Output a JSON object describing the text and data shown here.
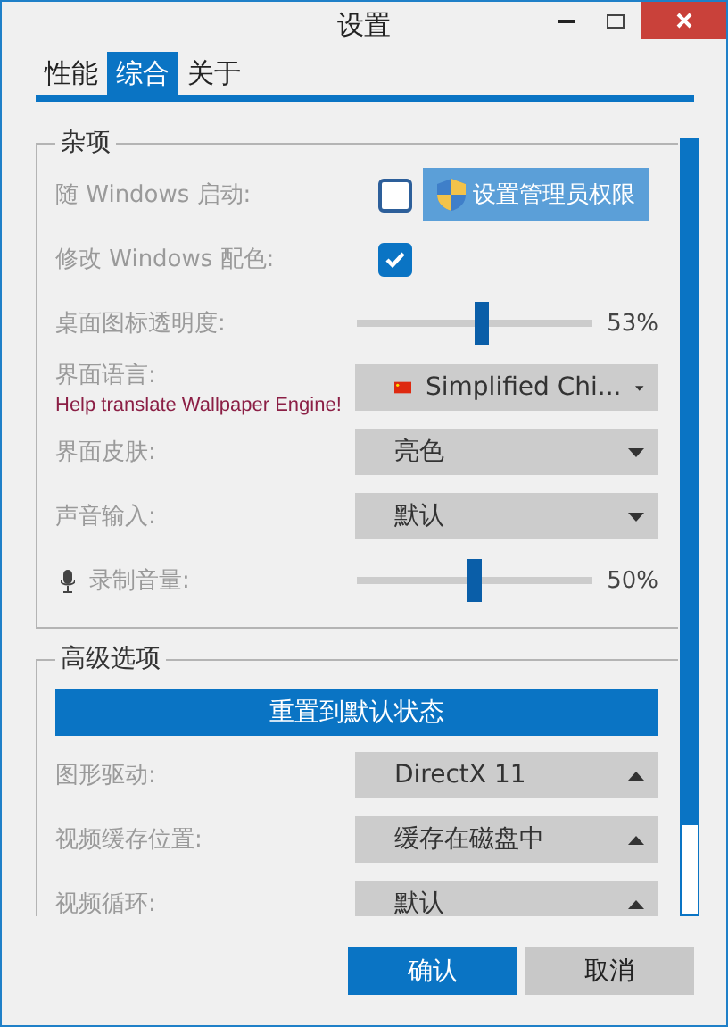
{
  "window": {
    "title": "设置"
  },
  "tabs": [
    {
      "label": "性能",
      "selected": false
    },
    {
      "label": "综合",
      "selected": true
    },
    {
      "label": "关于",
      "selected": false
    }
  ],
  "groups": [
    {
      "title": "杂项",
      "rows": [
        {
          "kind": "checkbox",
          "label": "随 Windows 启动:",
          "checked": false,
          "button": "设置管理员权限"
        },
        {
          "kind": "checkbox",
          "label": "修改 Windows 配色:",
          "checked": true
        },
        {
          "kind": "slider",
          "label": "桌面图标透明度:",
          "level": 0.53,
          "reading": "53%"
        },
        {
          "kind": "dropdown",
          "label": "界面语言:",
          "value": "Simplified Chi...",
          "flag": true,
          "link": "Help translate Wallpaper Engine!",
          "opens_up": false
        },
        {
          "kind": "dropdown",
          "label": "界面皮肤:",
          "value": "亮色",
          "opens_up": false
        },
        {
          "kind": "dropdown",
          "label": "声音输入:",
          "value": "默认",
          "opens_up": false
        },
        {
          "kind": "slider",
          "label": "录制音量:",
          "level": 0.5,
          "reading": "50%",
          "mic": true
        }
      ]
    },
    {
      "title": "高级选项",
      "action": "重置到默认状态",
      "rows": [
        {
          "kind": "dropdown",
          "label": "图形驱动:",
          "value": "DirectX 11",
          "opens_up": true
        },
        {
          "kind": "dropdown",
          "label": "视频缓存位置:",
          "value": "缓存在磁盘中",
          "opens_up": true
        },
        {
          "kind": "dropdown",
          "label": "视频循环:",
          "value": "默认",
          "opens_up": true
        }
      ]
    }
  ],
  "buttons": [
    {
      "label": "确认",
      "primary": true
    },
    {
      "label": "取消",
      "primary": false
    }
  ]
}
